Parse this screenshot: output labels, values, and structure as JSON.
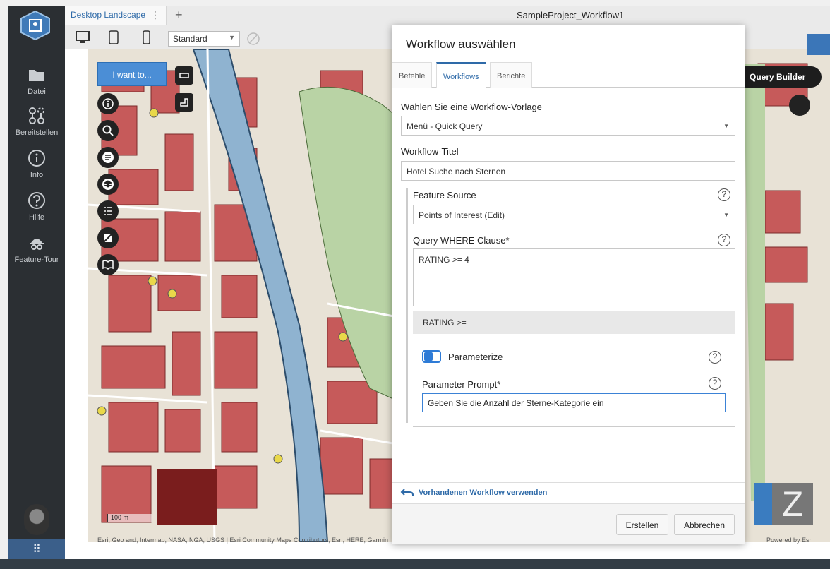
{
  "window": {
    "tab_label": "Desktop Landscape",
    "title": "SampleProject_Workflow1",
    "device_select": "Standard"
  },
  "sidebar": {
    "items": [
      {
        "label": "Datei",
        "icon": "folder-icon"
      },
      {
        "label": "Bereitstellen",
        "icon": "share-network-icon"
      },
      {
        "label": "Info",
        "icon": "info-icon"
      },
      {
        "label": "Hilfe",
        "icon": "help-icon"
      },
      {
        "label": "Feature-Tour",
        "icon": "tour-guide-icon"
      }
    ]
  },
  "map": {
    "iwant_label": "I want to...",
    "query_builder_label": "Query Builder",
    "scale_label": "100 m",
    "attribution": "Esri, Geo and, Intermap, NASA, NGA, USGS | Esri Community Maps Contributors, Esri, HERE, Garmin",
    "powered_by": "Powered by Esri"
  },
  "dialog": {
    "title": "Workflow auswählen",
    "tabs": [
      "Befehle",
      "Workflows",
      "Berichte"
    ],
    "template_label": "Wählen Sie eine Workflow-Vorlage",
    "template_value": "Menü - Quick Query",
    "title_label": "Workflow-Titel",
    "title_value": "Hotel Suche nach Sternen",
    "feature_source_label": "Feature Source",
    "feature_source_value": "Points of Interest (Edit)",
    "where_label": "Query WHERE Clause*",
    "where_value": "RATING >= 4",
    "rating_band": "RATING >=",
    "parameterize_label": "Parameterize",
    "prompt_label": "Parameter Prompt*",
    "prompt_value": "Geben Sie die Anzahl der Sterne-Kategorie ein",
    "use_existing_label": "Vorhandenen Workflow verwenden",
    "create_label": "Erstellen",
    "cancel_label": "Abbrechen",
    "help_glyph": "?"
  }
}
